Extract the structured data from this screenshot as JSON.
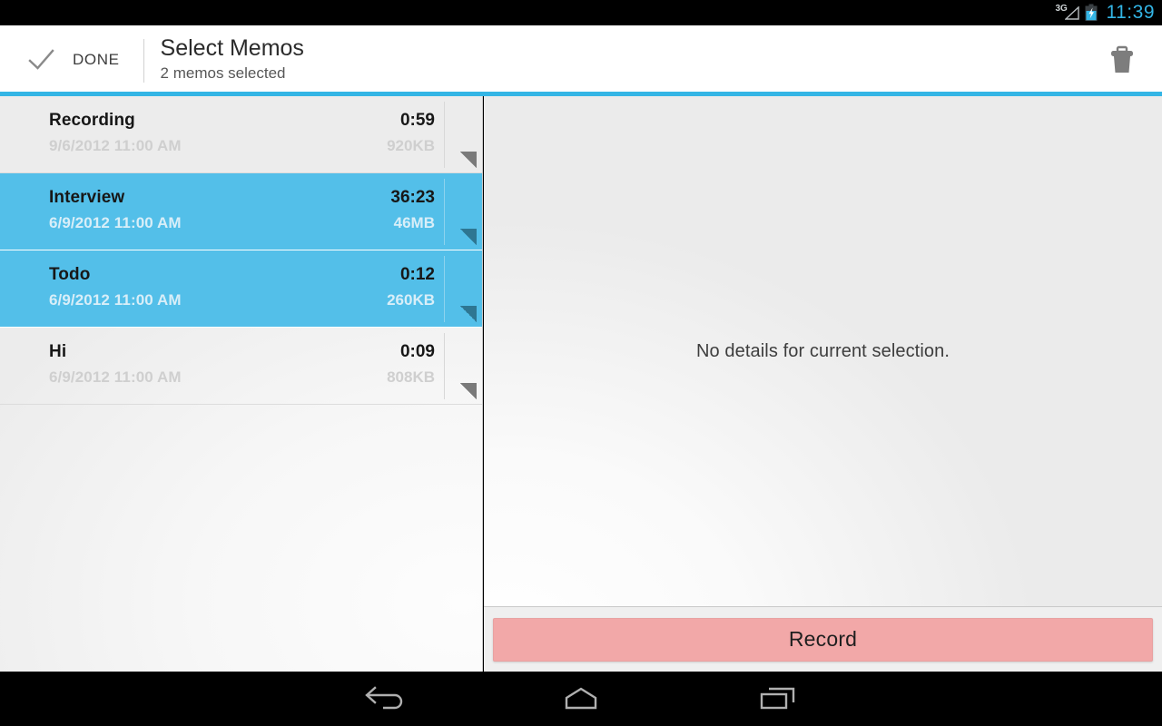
{
  "status_bar": {
    "network_label": "3G",
    "signal_icon": "signal-triangle-icon",
    "battery_icon": "battery-charging-icon",
    "clock": "11:39",
    "clock_color": "#33b5e5"
  },
  "action_bar": {
    "done_icon": "checkmark-icon",
    "done_label": "DONE",
    "title": "Select Memos",
    "subtitle": "2 memos selected",
    "delete_icon": "trash-icon",
    "accent_color": "#33b5e5"
  },
  "memo_list": {
    "selected_color": "#53bfe9",
    "items": [
      {
        "title": "Recording",
        "date": "9/6/2012 11:00 AM",
        "duration": "0:59",
        "size": "920KB",
        "selected": false
      },
      {
        "title": "Interview",
        "date": "6/9/2012 11:00 AM",
        "duration": "36:23",
        "size": "46MB",
        "selected": true
      },
      {
        "title": "Todo",
        "date": "6/9/2012 11:00 AM",
        "duration": "0:12",
        "size": "260KB",
        "selected": true
      },
      {
        "title": "Hi",
        "date": "6/9/2012 11:00 AM",
        "duration": "0:09",
        "size": "808KB",
        "selected": false
      }
    ]
  },
  "detail_pane": {
    "empty_message": "No details for current selection.",
    "record_label": "Record",
    "record_color": "#f2a8a8"
  },
  "nav_bar": {
    "back_icon": "back-arrow-icon",
    "home_icon": "home-icon",
    "recent_icon": "recent-apps-icon"
  }
}
